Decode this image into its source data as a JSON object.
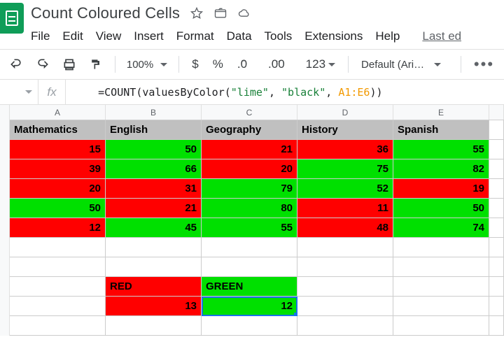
{
  "doc": {
    "title": "Count Coloured Cells",
    "last_edit": "Last ed"
  },
  "menu": {
    "file": "File",
    "edit": "Edit",
    "view": "View",
    "insert": "Insert",
    "format": "Format",
    "data": "Data",
    "tools": "Tools",
    "extensions": "Extensions",
    "help": "Help"
  },
  "toolbar": {
    "zoom": "100%",
    "currency": "$",
    "percent": "%",
    "dec_dec": ".0",
    "inc_dec": ".00",
    "numfmt": "123",
    "font": "Default (Ari…",
    "more": "•••"
  },
  "formula": {
    "fx": "fx",
    "raw": "=COUNT(valuesByColor(\"lime\", \"black\", A1:E6))",
    "parts": {
      "p0": "=COUNT",
      "p1": "(",
      "p2": "valuesByColor",
      "p3": "(",
      "p4": "\"lime\"",
      "p5": ", ",
      "p6": "\"black\"",
      "p7": ", ",
      "p8": "A1:E6",
      "p9": "))"
    }
  },
  "columns": {
    "A": "A",
    "B": "B",
    "C": "C",
    "D": "D",
    "E": "E"
  },
  "headers": {
    "A": "Mathematics",
    "B": "English",
    "C": "Geography",
    "D": "History",
    "E": "Spanish"
  },
  "data": {
    "r2": {
      "A": "15",
      "B": "50",
      "C": "21",
      "D": "36",
      "E": "55"
    },
    "r3": {
      "A": "39",
      "B": "66",
      "C": "20",
      "D": "75",
      "E": "82"
    },
    "r4": {
      "A": "20",
      "B": "31",
      "C": "79",
      "D": "52",
      "E": "19"
    },
    "r5": {
      "A": "50",
      "B": "21",
      "C": "80",
      "D": "11",
      "E": "50"
    },
    "r6": {
      "A": "12",
      "B": "45",
      "C": "55",
      "D": "48",
      "E": "74"
    }
  },
  "colors": {
    "r2": {
      "A": "red",
      "B": "green",
      "C": "red",
      "D": "red",
      "E": "green"
    },
    "r3": {
      "A": "red",
      "B": "green",
      "C": "red",
      "D": "green",
      "E": "green"
    },
    "r4": {
      "A": "red",
      "B": "red",
      "C": "green",
      "D": "green",
      "E": "red"
    },
    "r5": {
      "A": "green",
      "B": "red",
      "C": "green",
      "D": "red",
      "E": "green"
    },
    "r6": {
      "A": "red",
      "B": "green",
      "C": "green",
      "D": "red",
      "E": "green"
    }
  },
  "summary": {
    "red_label": "RED",
    "green_label": "GREEN",
    "red_count": "13",
    "green_count": "12"
  },
  "chart_data": {
    "type": "table",
    "title": "Count Coloured Cells",
    "columns": [
      "Mathematics",
      "English",
      "Geography",
      "History",
      "Spanish"
    ],
    "values": [
      [
        15,
        50,
        21,
        36,
        55
      ],
      [
        39,
        66,
        20,
        75,
        82
      ],
      [
        20,
        31,
        79,
        52,
        19
      ],
      [
        50,
        21,
        80,
        11,
        50
      ],
      [
        12,
        45,
        55,
        48,
        74
      ]
    ],
    "cell_colors": [
      [
        "red",
        "green",
        "red",
        "red",
        "green"
      ],
      [
        "red",
        "green",
        "red",
        "green",
        "green"
      ],
      [
        "red",
        "red",
        "green",
        "green",
        "red"
      ],
      [
        "green",
        "red",
        "green",
        "red",
        "green"
      ],
      [
        "red",
        "green",
        "green",
        "red",
        "green"
      ]
    ],
    "counts": {
      "RED": 13,
      "GREEN": 12
    }
  }
}
